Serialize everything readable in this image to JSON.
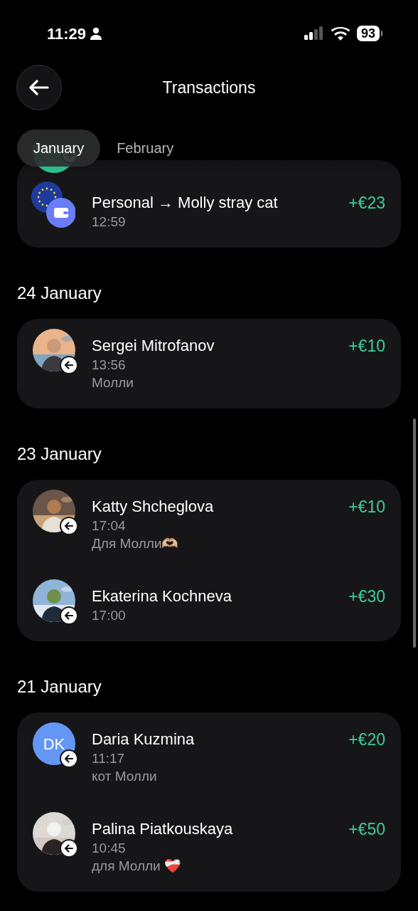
{
  "status_bar": {
    "time": "11:29",
    "battery": "93"
  },
  "header": {
    "title": "Transactions"
  },
  "tabs": [
    {
      "label": "January",
      "selected": true
    },
    {
      "label": "February",
      "selected": false
    }
  ],
  "sections": [
    {
      "rows": [
        {
          "avatar": {
            "kind": "topup"
          },
          "badge": {
            "kind": "plus"
          }
        },
        {
          "avatar": {
            "kind": "wallet"
          },
          "name": "Personal → Molly stray cat",
          "time": "12:59",
          "amount": "+€23"
        }
      ]
    },
    {
      "date": "24 January",
      "rows": [
        {
          "badge": {
            "kind": "arrow"
          },
          "name": "Sergei Mitrofanov",
          "time": "13:56",
          "note": "Молли",
          "amount": "+€10"
        }
      ]
    },
    {
      "date": "23 January",
      "rows": [
        {
          "badge": {
            "kind": "arrow"
          },
          "name": "Katty Shcheglova",
          "time": "17:04",
          "note": "Для Молли🫶🏼",
          "amount": "+€10"
        },
        {
          "badge": {
            "kind": "arrow"
          },
          "name": "Ekaterina Kochneva",
          "time": "17:00",
          "amount": "+€30"
        }
      ]
    },
    {
      "date": "21 January",
      "rows": [
        {
          "avatar": {
            "kind": "initials",
            "initials": "DK",
            "color": "#6496f5"
          },
          "badge": {
            "kind": "arrow"
          },
          "name": "Daria Kuzmina",
          "time": "11:17",
          "note": "кот Молли",
          "amount": "+€20"
        },
        {
          "badge": {
            "kind": "arrow"
          },
          "name": "Palina Piatkouskaya",
          "time": "10:45",
          "note": "для Молли ❤️‍🩹",
          "amount": "+€50"
        }
      ]
    }
  ]
}
